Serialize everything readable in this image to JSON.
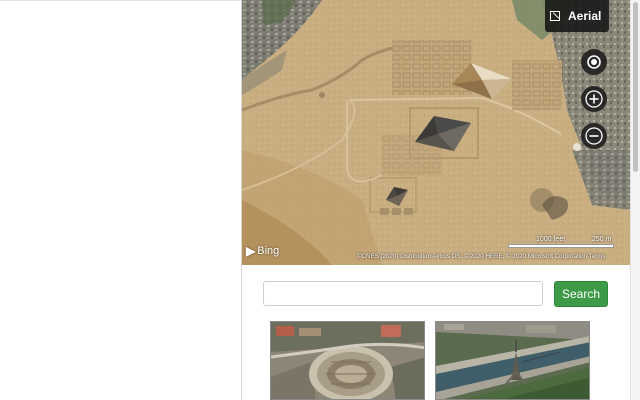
{
  "map": {
    "style_button": {
      "label": "Aerial",
      "icon": "aerial-map-icon"
    },
    "controls": {
      "locate_icon": "locate-target-icon",
      "zoom_in_icon": "plus-icon",
      "zoom_out_icon": "minus-icon"
    },
    "branding": {
      "logo_text": "Bing"
    },
    "scale": {
      "label_feet": "1000 feet",
      "label_metric": "250 m"
    },
    "copyright": "©CNES (2020) Distribution Airbus DS, © 2020 HERE, © 2020 Microsoft Corporation  Terms"
  },
  "search": {
    "value": "",
    "placeholder": "",
    "button_label": "Search"
  },
  "thumbnails": [
    {
      "subject": "colosseum-aerial-image"
    },
    {
      "subject": "eiffel-tower-aerial-image"
    }
  ],
  "colors": {
    "search_button": "#3d9a46",
    "map_sand": "#c8ad80",
    "control_background": "#191919"
  }
}
